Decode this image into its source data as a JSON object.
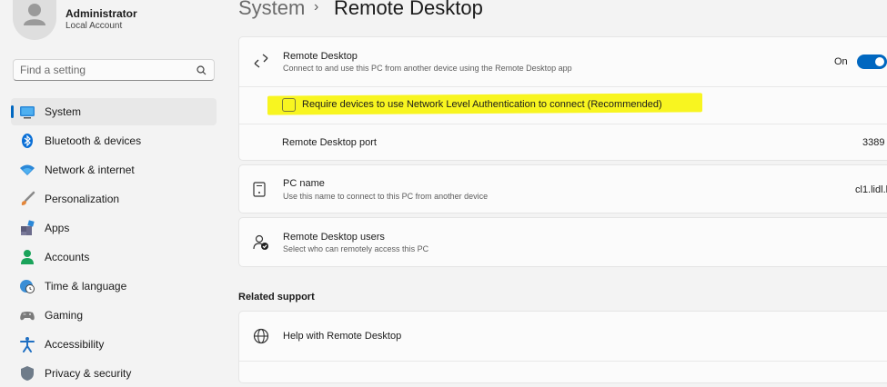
{
  "user": {
    "name": "Administrator",
    "account_type": "Local Account"
  },
  "search": {
    "placeholder": "Find a setting"
  },
  "sidebar": {
    "items": [
      {
        "label": "System",
        "icon": "system-icon",
        "active": true
      },
      {
        "label": "Bluetooth & devices",
        "icon": "bluetooth-icon"
      },
      {
        "label": "Network & internet",
        "icon": "network-icon"
      },
      {
        "label": "Personalization",
        "icon": "brush-icon"
      },
      {
        "label": "Apps",
        "icon": "apps-icon"
      },
      {
        "label": "Accounts",
        "icon": "accounts-icon"
      },
      {
        "label": "Time & language",
        "icon": "globe-clock-icon"
      },
      {
        "label": "Gaming",
        "icon": "gamepad-icon"
      },
      {
        "label": "Accessibility",
        "icon": "accessibility-icon"
      },
      {
        "label": "Privacy & security",
        "icon": "shield-icon"
      }
    ]
  },
  "breadcrumb": {
    "parent": "System",
    "separator": "›",
    "current": "Remote Desktop"
  },
  "remote_desktop": {
    "title": "Remote Desktop",
    "subtitle": "Connect to and use this PC from another device using the Remote Desktop app",
    "toggle_label": "On",
    "toggle_on": true,
    "nla_label": "Require devices to use Network Level Authentication to connect (Recommended)",
    "nla_checked": false,
    "port_label": "Remote Desktop port",
    "port_value": "3389"
  },
  "pc_name": {
    "title": "PC name",
    "subtitle": "Use this name to connect to this PC from another device",
    "value": "cl1.lidl.l"
  },
  "users": {
    "title": "Remote Desktop users",
    "subtitle": "Select who can remotely access this PC"
  },
  "related_support": {
    "heading": "Related support",
    "items": [
      {
        "label": "Help with Remote Desktop",
        "icon": "globe-icon"
      }
    ]
  },
  "colors": {
    "accent": "#0067c0",
    "highlight": "#f8f520",
    "background": "#f3f3f3",
    "card": "#fbfbfb"
  }
}
